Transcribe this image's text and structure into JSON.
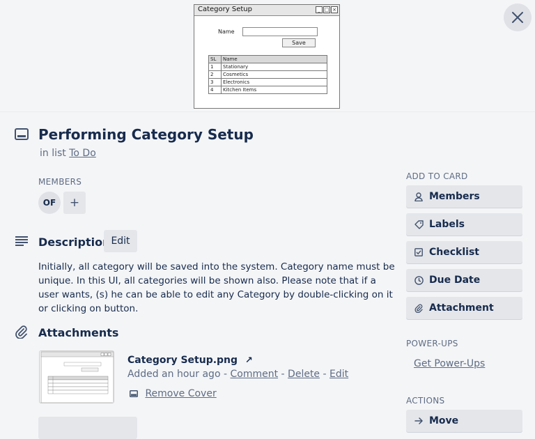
{
  "cover": {
    "mockup": {
      "window_title": "Category Setup",
      "name_label": "Name",
      "save_label": "Save",
      "table_headers": [
        "SL",
        "Name"
      ],
      "table_rows": [
        [
          "1",
          "Stationary"
        ],
        [
          "2",
          "Cosmetics"
        ],
        [
          "3",
          "Electronics"
        ],
        [
          "4",
          "Kitchen Items"
        ]
      ]
    },
    "close_icon": "close-icon"
  },
  "card": {
    "title": "Performing Category Setup",
    "in_list_prefix": "in list",
    "list_name": "To Do"
  },
  "members": {
    "label": "MEMBERS",
    "avatar_initials": "OF",
    "add_label": "+"
  },
  "description": {
    "heading": "Description",
    "edit_label": "Edit",
    "text": "Initially, all category will be saved into the system. Category name must be unique. In this UI, all categories will be shown also. Please note that if a user wants, (s) he can be able to edit any Category by double-clicking on it or clicking on button."
  },
  "attachments": {
    "heading": "Attachments",
    "file_name": "Category Setup.png",
    "added": "Added an hour ago",
    "sep": "-",
    "comment": "Comment",
    "delete": "Delete",
    "edit": "Edit",
    "remove_cover": "Remove Cover"
  },
  "sidebar": {
    "add_to_card_label": "ADD TO CARD",
    "buttons": [
      {
        "label": "Members",
        "icon": "person-icon"
      },
      {
        "label": "Labels",
        "icon": "tag-icon"
      },
      {
        "label": "Checklist",
        "icon": "checkbox-icon"
      },
      {
        "label": "Due Date",
        "icon": "clock-icon"
      },
      {
        "label": "Attachment",
        "icon": "paperclip-icon"
      }
    ],
    "powerups_label": "POWER-UPS",
    "get_powerups": "Get Power-Ups",
    "actions_label": "ACTIONS",
    "move_label": "Move"
  }
}
